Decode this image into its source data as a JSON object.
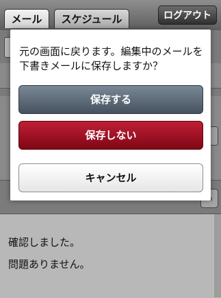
{
  "tabs": [
    {
      "label": "メール",
      "active": true
    },
    {
      "label": "スケジュール",
      "active": false
    }
  ],
  "header": {
    "logout_label": "ログアウト"
  },
  "compose": {
    "body_lines": [
      "確認しました。",
      "問題ありません。"
    ]
  },
  "dialog": {
    "message": "元の画面に戻ります。編集中のメールを下書きメールに保存しますか？",
    "save_label": "保存する",
    "nosave_label": "保存しない",
    "cancel_label": "キャンセル"
  },
  "colors": {
    "save_button": "#5f6d7a",
    "nosave_button": "#a0142a",
    "cancel_button": "#f4f4f4"
  },
  "icons": {
    "compose_tool": "pen-icon"
  }
}
